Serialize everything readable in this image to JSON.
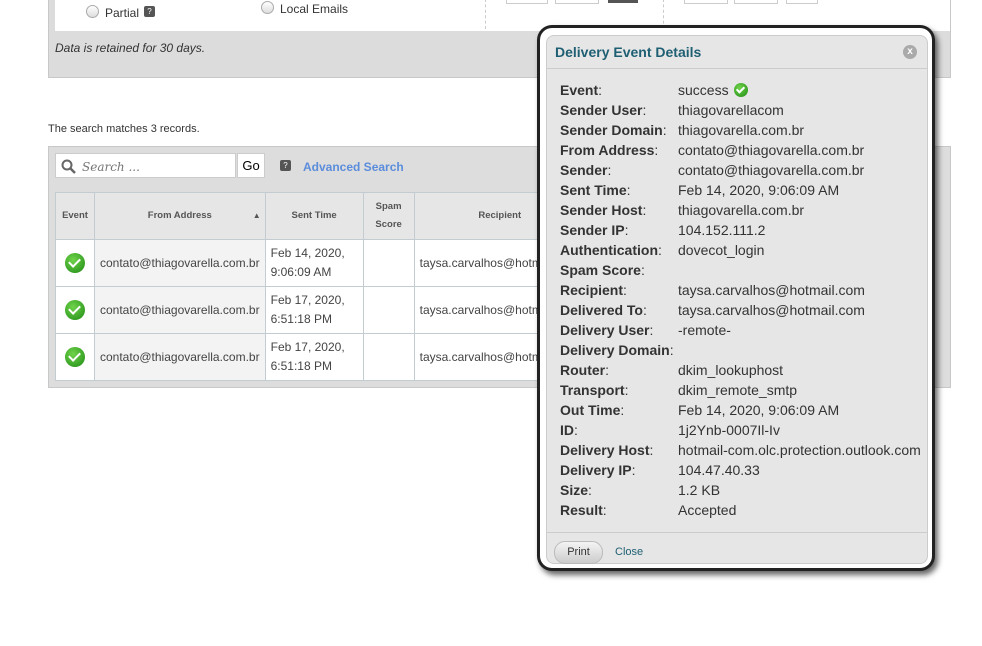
{
  "filters": {
    "partial_label": "Partial",
    "local_emails_label": "Local Emails",
    "retention_note": "Data is retained for 30 days."
  },
  "results": {
    "summary": "The search matches 3 records.",
    "search_placeholder": "Search ...",
    "go_label": "Go",
    "advanced_search_label": "Advanced Search",
    "columns": [
      "Event",
      "From Address",
      "Sent Time",
      "Spam Score",
      "Recipient"
    ],
    "rows": [
      {
        "event": "success",
        "from": "contato@thiagovarella.com.br",
        "sent": "Feb 14, 2020, 9:06:09 AM",
        "spam": "",
        "recipient": "taysa.carvalhos@hotmail.com"
      },
      {
        "event": "success",
        "from": "contato@thiagovarella.com.br",
        "sent": "Feb 17, 2020, 6:51:18 PM",
        "spam": "",
        "recipient": "taysa.carvalhos@hotmail.com"
      },
      {
        "event": "success",
        "from": "contato@thiagovarella.com.br",
        "sent": "Feb 17, 2020, 6:51:18 PM",
        "spam": "",
        "recipient": "taysa.carvalhos@hotmail.com"
      }
    ]
  },
  "modal": {
    "title": "Delivery Event Details",
    "close_x": "x",
    "print_label": "Print",
    "close_label": "Close",
    "fields": [
      {
        "label": "Event",
        "value": "success"
      },
      {
        "label": "Sender User",
        "value": "thiagovarellacom"
      },
      {
        "label": "Sender Domain",
        "value": "thiagovarella.com.br"
      },
      {
        "label": "From Address",
        "value": "contato@thiagovarella.com.br"
      },
      {
        "label": "Sender",
        "value": "contato@thiagovarella.com.br"
      },
      {
        "label": "Sent Time",
        "value": "Feb 14, 2020, 9:06:09 AM"
      },
      {
        "label": "Sender Host",
        "value": "thiagovarella.com.br"
      },
      {
        "label": "Sender IP",
        "value": "104.152.111.2"
      },
      {
        "label": "Authentication",
        "value": "dovecot_login"
      },
      {
        "label": "Spam Score",
        "value": ""
      },
      {
        "label": "Recipient",
        "value": "taysa.carvalhos@hotmail.com"
      },
      {
        "label": "Delivered To",
        "value": "taysa.carvalhos@hotmail.com"
      },
      {
        "label": "Delivery User",
        "value": "-remote-"
      },
      {
        "label": "Delivery Domain",
        "value": ""
      },
      {
        "label": "Router",
        "value": "dkim_lookuphost"
      },
      {
        "label": "Transport",
        "value": "dkim_remote_smtp"
      },
      {
        "label": "Out Time",
        "value": "Feb 14, 2020, 9:06:09 AM"
      },
      {
        "label": "ID",
        "value": "1j2Ynb-0007Il-Iv"
      },
      {
        "label": "Delivery Host",
        "value": "hotmail-com.olc.protection.outlook.com"
      },
      {
        "label": "Delivery IP",
        "value": "104.47.40.33"
      },
      {
        "label": "Size",
        "value": "1.2 KB"
      },
      {
        "label": "Result",
        "value": "Accepted"
      }
    ]
  }
}
